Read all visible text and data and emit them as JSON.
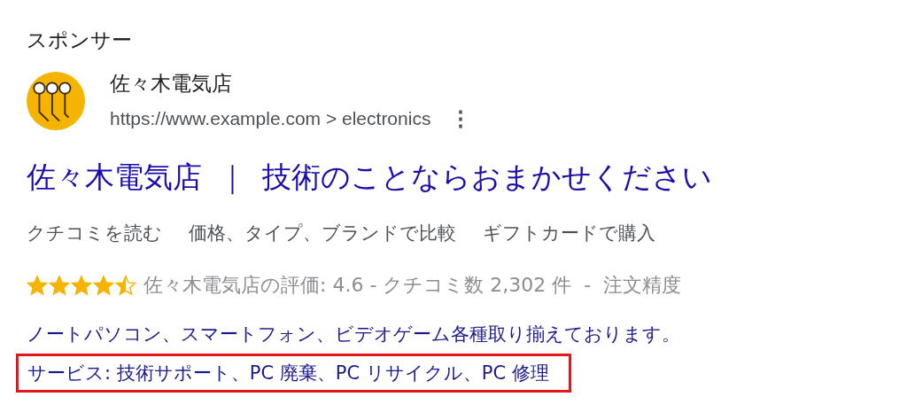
{
  "label": "スポンサー",
  "advertiser": {
    "name": "佐々木電気店",
    "url": "https://www.example.com > electronics",
    "menu": "⋮"
  },
  "headline": {
    "name": "佐々木電気店",
    "separator": "｜",
    "tagline": "技術のことならおまかせください"
  },
  "sitelinks": [
    "クチコミを読む",
    "価格、タイプ、ブランドで比較",
    "ギフトカードで購入"
  ],
  "rating": {
    "stars": 4.5,
    "text": "佐々木電気店の評価: 4.6 - クチコミ数 2,302 件  -  注文精度"
  },
  "description": "ノートパソコン、スマートフォン、ビデオゲーム各種取り揃えております。",
  "services": {
    "text": "サービス: 技術サポート、PC 廃棄、PC リサイクル、PC 修理",
    "highlighted": true
  }
}
